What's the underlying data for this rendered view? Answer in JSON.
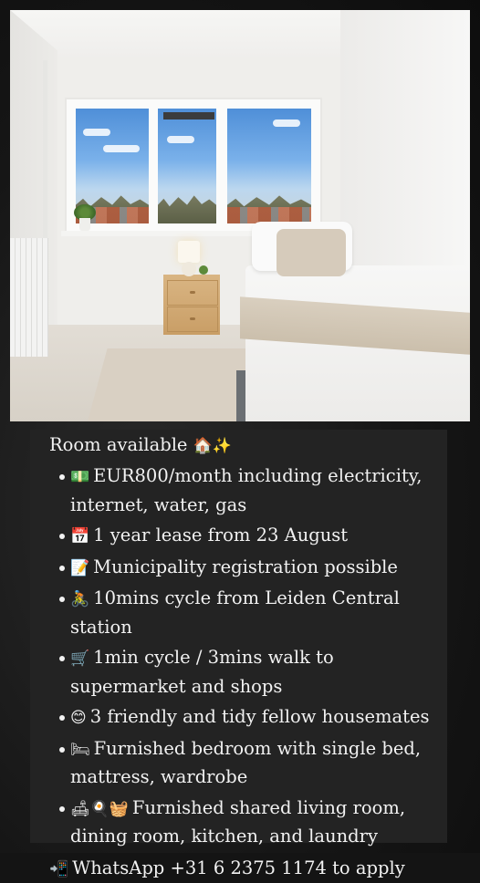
{
  "listing": {
    "heading_text": "Room available",
    "heading_emoji": "🏠✨",
    "bullets": [
      {
        "emoji": "💵",
        "text": "EUR800/month including electricity, internet, water, gas"
      },
      {
        "emoji": "📅",
        "text": "1 year lease from 23 August"
      },
      {
        "emoji": "📝",
        "text": "Municipality registration possible"
      },
      {
        "emoji": "🚴",
        "text": "10mins cycle from Leiden Central station"
      },
      {
        "emoji": "🛒",
        "text": "1min cycle / 3mins walk to supermarket and shops"
      },
      {
        "emoji": "😊",
        "text": "3 friendly and tidy fellow housemates"
      },
      {
        "emoji": "🛏",
        "text": "Furnished bedroom with single bed, mattress, wardrobe"
      },
      {
        "emoji": "🛋🍳🧺",
        "text": "Furnished shared living room, dining room, kitchen, and laundry"
      }
    ],
    "footer_emoji": "📲",
    "footer_text": "WhatsApp +31 6 2375 1174 to apply"
  }
}
